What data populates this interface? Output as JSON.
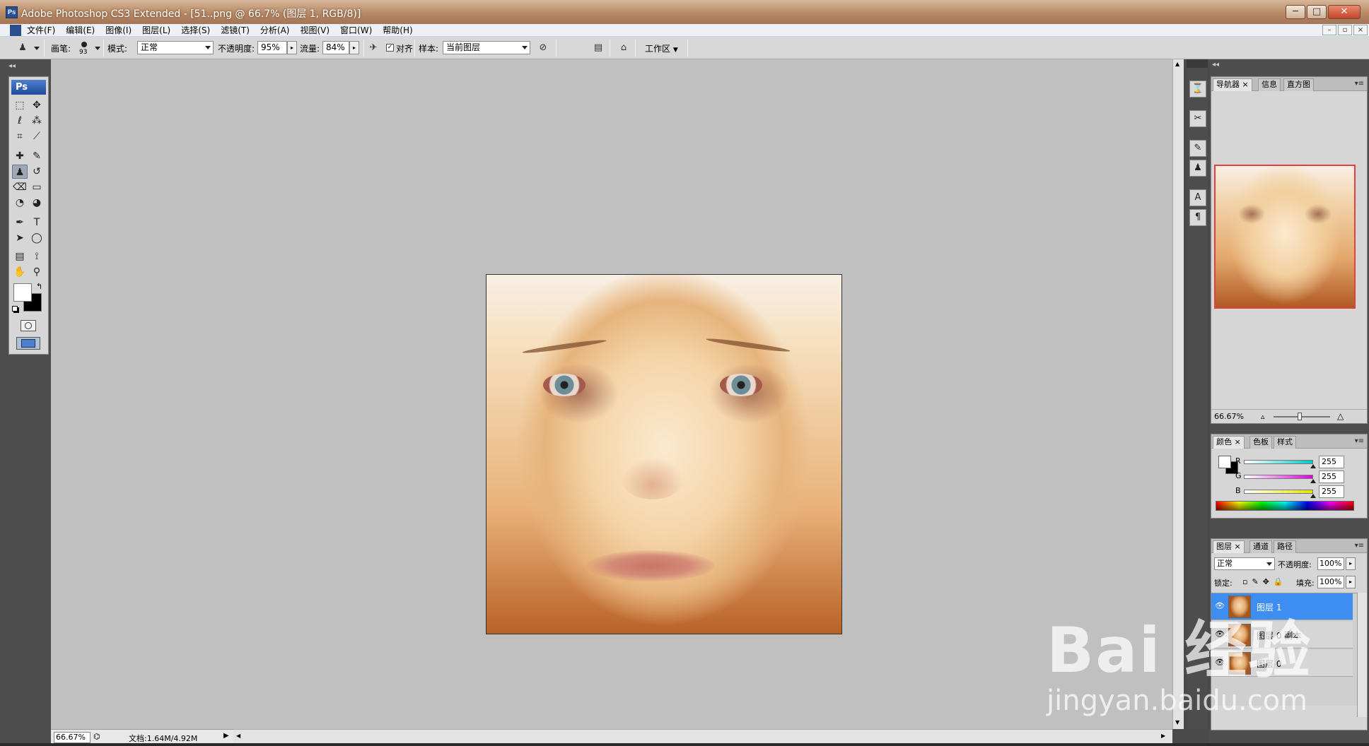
{
  "window": {
    "title": "Adobe Photoshop CS3 Extended - [51..png @ 66.7% (图层 1, RGB/8)]",
    "app_icon_label": "Ps",
    "controls": [
      "─",
      "□",
      "✕"
    ]
  },
  "menubar": {
    "items": [
      "文件(F)",
      "编辑(E)",
      "图像(I)",
      "图层(L)",
      "选择(S)",
      "滤镜(T)",
      "分析(A)",
      "视图(V)",
      "窗口(W)",
      "帮助(H)"
    ],
    "doc_controls": [
      "–",
      "▫",
      "×"
    ]
  },
  "options": {
    "brush_label": "画笔:",
    "brush_size": "93",
    "mode_label": "模式:",
    "mode_value": "正常",
    "opacity_label": "不透明度:",
    "opacity_value": "95%",
    "flow_label": "流量:",
    "flow_value": "84%",
    "aligned_label": "对齐",
    "sample_label": "样本:",
    "sample_value": "当前图层",
    "workspace_label": "工作区"
  },
  "toolbox": {
    "header": "Ps",
    "tools": [
      {
        "name": "marquee-tool-icon",
        "glyph": "⬚"
      },
      {
        "name": "move-tool-icon",
        "glyph": "✥"
      },
      {
        "name": "lasso-tool-icon",
        "glyph": "ℓ"
      },
      {
        "name": "magic-wand-tool-icon",
        "glyph": "⁂"
      },
      {
        "name": "crop-tool-icon",
        "glyph": "⌗"
      },
      {
        "name": "slice-tool-icon",
        "glyph": "⟋"
      },
      {
        "name": "healing-brush-tool-icon",
        "glyph": "✚"
      },
      {
        "name": "brush-tool-icon",
        "glyph": "✎"
      },
      {
        "name": "clone-stamp-tool-icon",
        "glyph": "♟"
      },
      {
        "name": "history-brush-tool-icon",
        "glyph": "↺"
      },
      {
        "name": "eraser-tool-icon",
        "glyph": "⌫"
      },
      {
        "name": "gradient-tool-icon",
        "glyph": "▭"
      },
      {
        "name": "blur-tool-icon",
        "glyph": "◔"
      },
      {
        "name": "dodge-tool-icon",
        "glyph": "◕"
      },
      {
        "name": "pen-tool-icon",
        "glyph": "✒"
      },
      {
        "name": "type-tool-icon",
        "glyph": "T"
      },
      {
        "name": "path-selection-tool-icon",
        "glyph": "➤"
      },
      {
        "name": "shape-tool-icon",
        "glyph": "◯"
      },
      {
        "name": "notes-tool-icon",
        "glyph": "▤"
      },
      {
        "name": "eyedropper-tool-icon",
        "glyph": "⟟"
      },
      {
        "name": "hand-tool-icon",
        "glyph": "✋"
      },
      {
        "name": "zoom-tool-icon",
        "glyph": "⚲"
      }
    ],
    "selected_tool": "clone-stamp-tool-icon",
    "foreground_color": "#ffffff",
    "background_color": "#000000"
  },
  "status": {
    "zoom": "66.67%",
    "doc_size": "文档:1.64M/4.92M"
  },
  "navigator_panel": {
    "tabs": [
      "导航器",
      "信息",
      "直方图"
    ],
    "zoom": "66.67%"
  },
  "color_panel": {
    "tabs": [
      "颜色",
      "色板",
      "样式"
    ],
    "channels": [
      {
        "label": "R",
        "value": "255",
        "color": "#00c8c8"
      },
      {
        "label": "G",
        "value": "255",
        "color": "#e000e0"
      },
      {
        "label": "B",
        "value": "255",
        "color": "#e6e600"
      }
    ]
  },
  "layers_panel": {
    "tabs": [
      "图层",
      "通道",
      "路径"
    ],
    "blend_mode": "正常",
    "opacity_label": "不透明度:",
    "opacity_value": "100%",
    "lock_label": "锁定:",
    "fill_label": "填充:",
    "fill_value": "100%",
    "layers": [
      {
        "name": "图层 1",
        "selected": true
      },
      {
        "name": "图层 0 副本",
        "selected": false
      },
      {
        "name": "图层 0",
        "selected": false
      }
    ]
  },
  "watermark": {
    "brand": "Bai 经验",
    "url": "jingyan.baidu.com"
  },
  "colors": {
    "accent_selection": "#3d8ef0",
    "canvas_bg": "#c0c0c0",
    "dock_bg": "#4d4d4d"
  }
}
